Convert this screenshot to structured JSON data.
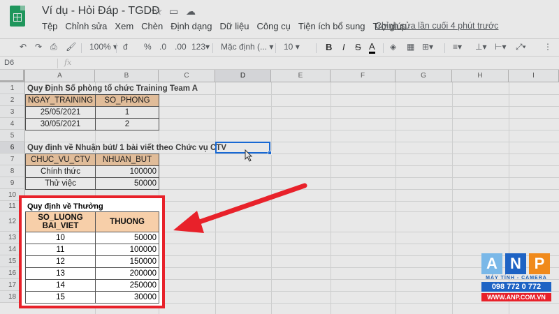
{
  "header": {
    "doc_title": "Ví dụ - Hỏi Đáp - TGDĐ",
    "menu": [
      "Tệp",
      "Chỉnh sửa",
      "Xem",
      "Chèn",
      "Định dạng",
      "Dữ liệu",
      "Công cụ",
      "Tiện ích bổ sung",
      "Trợ giúp"
    ],
    "last_edit": "Chỉnh sửa lần cuối 4 phút trước"
  },
  "toolbar": {
    "zoom": "100%",
    "currency": "đ",
    "percent": "%",
    "dec_less": ".0",
    "dec_more": ".00",
    "more_formats": "123",
    "font": "Mặc định (...",
    "font_size": "10",
    "bold": "B",
    "italic": "I",
    "strike": "S",
    "text_color": "A"
  },
  "formula_bar": {
    "name_box": "D6",
    "fx": "fx",
    "value": ""
  },
  "columns": [
    "A",
    "B",
    "C",
    "D",
    "E",
    "F",
    "G",
    "H",
    "I"
  ],
  "rows": [
    "1",
    "2",
    "3",
    "4",
    "5",
    "6",
    "7",
    "8",
    "9",
    "10",
    "11",
    "12",
    "13",
    "14",
    "15",
    "16",
    "17",
    "18"
  ],
  "sheet": {
    "title1": "Quy Định Số phòng tổ chức Training Team A",
    "t1_headers": [
      "NGAY_TRAINING",
      "SO_PHONG"
    ],
    "t1_rows": [
      [
        "25/05/2021",
        "1"
      ],
      [
        "30/05/2021",
        "2"
      ]
    ],
    "title2": "Quy định về Nhuận bút/ 1 bài viết theo Chức vụ CTV",
    "t2_headers": [
      "CHUC_VU_CTV",
      "NHUAN_BUT"
    ],
    "t2_rows": [
      [
        "Chính thức",
        "100000"
      ],
      [
        "Thử việc",
        "50000"
      ]
    ],
    "title3": "Quy định về Thưởng",
    "t3_header_a1": "SO_LUONG",
    "t3_header_a2": "BAI_VIET",
    "t3_header_b": "THUONG",
    "t3_rows": [
      [
        "10",
        "50000"
      ],
      [
        "11",
        "100000"
      ],
      [
        "12",
        "150000"
      ],
      [
        "13",
        "200000"
      ],
      [
        "14",
        "250000"
      ],
      [
        "15",
        "30000"
      ]
    ]
  },
  "brand": {
    "letters": [
      "A",
      "N",
      "P"
    ],
    "tagline": "MÁY TÍNH - CAMERA",
    "phone": "098 772 0 772",
    "web": "WWW.ANP.COM.VN"
  },
  "colors": {
    "header_fill": "#f7cfa9",
    "highlight_red": "#e8212a",
    "selection_blue": "#1a73e8"
  }
}
